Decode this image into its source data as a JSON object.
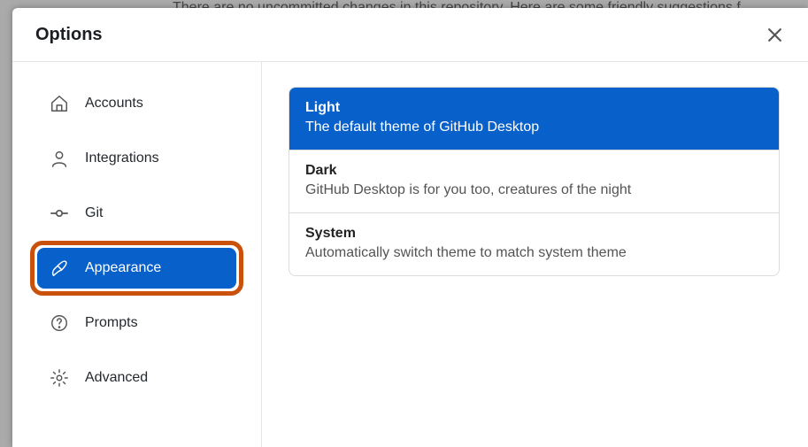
{
  "background_text": "There are no uncommitted changes in this repository. Here are some friendly suggestions f",
  "dialog": {
    "title": "Options"
  },
  "sidebar": {
    "items": [
      {
        "label": "Accounts"
      },
      {
        "label": "Integrations"
      },
      {
        "label": "Git"
      },
      {
        "label": "Appearance"
      },
      {
        "label": "Prompts"
      },
      {
        "label": "Advanced"
      }
    ]
  },
  "themes": [
    {
      "title": "Light",
      "desc": "The default theme of GitHub Desktop"
    },
    {
      "title": "Dark",
      "desc": "GitHub Desktop is for you too, creatures of the night"
    },
    {
      "title": "System",
      "desc": "Automatically switch theme to match system theme"
    }
  ]
}
